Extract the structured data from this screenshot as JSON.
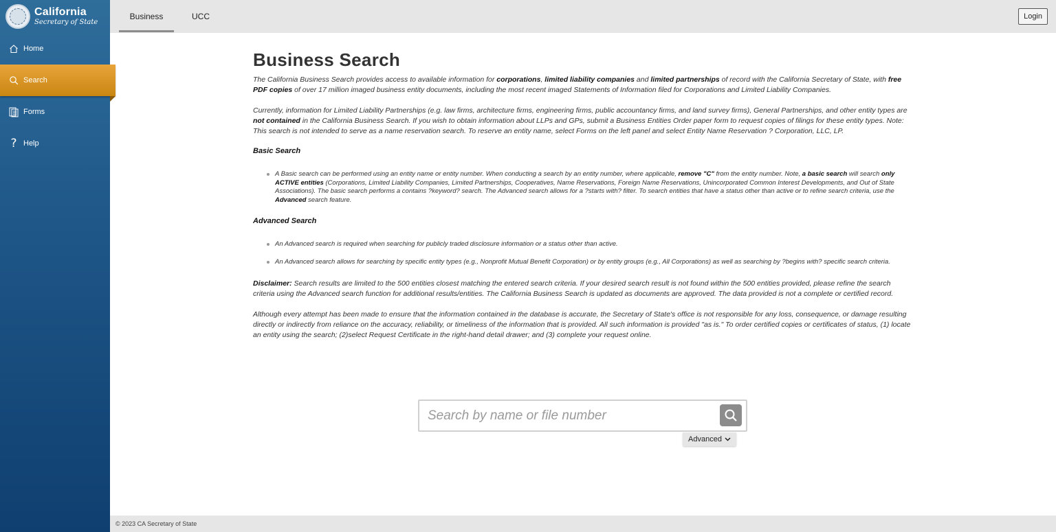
{
  "brand": {
    "title": "California",
    "subtitle": "Secretary of State"
  },
  "sidebar": {
    "items": [
      {
        "label": "Home",
        "icon": "home-icon"
      },
      {
        "label": "Search",
        "icon": "search-icon",
        "active": true
      },
      {
        "label": "Forms",
        "icon": "forms-icon"
      },
      {
        "label": "Help",
        "icon": "help-icon"
      }
    ]
  },
  "topbar": {
    "tabs": [
      {
        "label": "Business",
        "active": true
      },
      {
        "label": "UCC"
      }
    ],
    "login_label": "Login"
  },
  "main": {
    "title": "Business Search",
    "intro": {
      "t1": "The California Business Search provides access to available information for ",
      "b1": "corporations",
      "t2": ", ",
      "b2": "limited liability companies",
      "t3": " and ",
      "b3": "limited partnerships",
      "t4": " of record with the California Secretary of State, with ",
      "b4": "free PDF copies",
      "t5": " of over 17 million imaged business entity documents, including the most recent imaged Statements of Information filed for Corporations and Limited Liability Companies."
    },
    "currently": {
      "t1": "Currently, information for Limited Liability Partnerships (e.g. law firms, architecture firms, engineering firms, public accountancy firms, and land survey firms), General Partnerships, and other entity types are ",
      "b1": "not contained",
      "t2": " in the California Business Search. If you wish to obtain information about LLPs and GPs, submit a Business Entities Order paper form to request copies of filings for these entity types. Note: This search is not intended to serve as a name reservation search. To reserve an entity name, select Forms on the left panel and select Entity Name Reservation ? Corporation, LLC, LP."
    },
    "basic_heading": "Basic Search",
    "basic_item": {
      "t1": "A Basic search can be performed using an entity name or entity number. When conducting a search by an entity number, where applicable, ",
      "b1": "remove \"C\"",
      "t2": " from the entity number. Note, ",
      "b2": "a basic search",
      "t3": " will search ",
      "b3": "only ACTIVE entities",
      "t4": " (Corporations, Limited Liability Companies, Limited Partnerships, Cooperatives, Name Reservations, Foreign Name Reservations, Unincorporated Common Interest Developments, and Out of State Associations). The basic search performs a contains ?keyword? search. The Advanced search allows for a ?starts with? filter. To search entities that have a status other than active or to refine search criteria, use the ",
      "b4": "Advanced",
      "t5": " search feature."
    },
    "advanced_heading": "Advanced Search",
    "advanced_items": [
      "An Advanced search is required when searching for publicly traded disclosure information or a status other than active.",
      "An Advanced search allows for searching by specific entity types (e.g., Nonprofit Mutual Benefit Corporation) or by entity groups (e.g., All Corporations) as well as searching by ?begins with? specific search criteria."
    ],
    "disclaimer": {
      "b1": "Disclaimer:",
      "t1": " Search results are limited to the 500 entities closest matching the entered search criteria. If your desired search result is not found within the 500 entities provided, please refine the search criteria using the Advanced search function for additional results/entities. The California Business Search is updated as documents are approved. The data provided is not a complete or certified record."
    },
    "although": "Although every attempt has been made to ensure that the information contained in the database is accurate, the Secretary of State's office is not responsible for any loss, consequence, or damage resulting directly or indirectly from reliance on the accuracy, reliability, or timeliness of the information that is provided. All such information is provided \"as is.\" To order certified copies or certificates of status, (1) locate an entity using the search; (2)select Request Certificate in the right-hand detail drawer; and (3) complete your request online."
  },
  "search": {
    "placeholder": "Search by name or file number",
    "value": "",
    "advanced_label": "Advanced"
  },
  "footer": {
    "copyright": "© 2023 CA Secretary of State"
  }
}
